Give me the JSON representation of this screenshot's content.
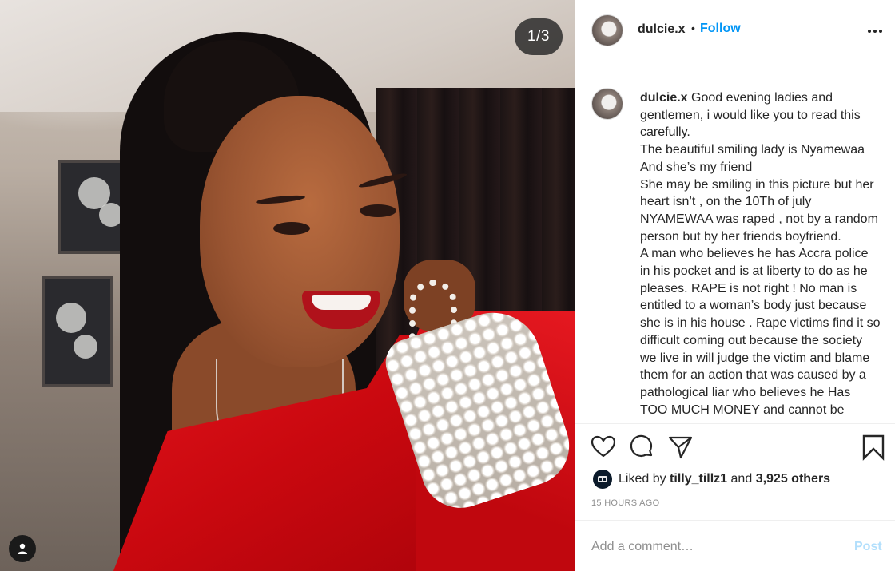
{
  "photo": {
    "counter": "1/3",
    "alt": "Smiling woman in a red dress holding a pearl handbag"
  },
  "header": {
    "username": "dulcie.x",
    "separator": "•",
    "follow_label": "Follow"
  },
  "caption": {
    "username": "dulcie.x",
    "lines": [
      "Good evening ladies and",
      "gentlemen, i would like you to read this",
      "carefully.",
      "The beautiful smiling lady is Nyamewaa",
      "And she’s my friend",
      "She may be smiling in this picture but her",
      "heart isn’t , on the 10Th of july",
      "NYAMEWAA was raped , not by a random",
      "person but by her friends boyfriend.",
      "A man who believes he has Accra police",
      "in his pocket and is at liberty to do as he",
      "pleases. RAPE is not right ! No man is",
      "entitled to a woman’s body just because",
      "she is in his house . Rape victims find it so",
      "difficult coming out because the society",
      "we live in will judge the victim and blame",
      "them for an action that was caused by a",
      "pathological liar who believes he Has",
      "TOO MUCH MONEY and cannot be"
    ]
  },
  "likes": {
    "prefix": "Liked by",
    "user": "tilly_tillz1",
    "joiner": "and",
    "others": "3,925 others"
  },
  "timestamp": "15 HOURS AGO",
  "comment": {
    "placeholder": "Add a comment…",
    "post_label": "Post"
  },
  "colors": {
    "link_blue": "#0095f6",
    "post_disabled": "#b2dffc",
    "muted": "#8e8e8e",
    "text": "#262626",
    "dress_red": "#d40c14"
  },
  "icons": [
    "user-tag-icon",
    "more-options-icon",
    "heart-icon",
    "comment-icon",
    "share-icon",
    "bookmark-icon"
  ]
}
